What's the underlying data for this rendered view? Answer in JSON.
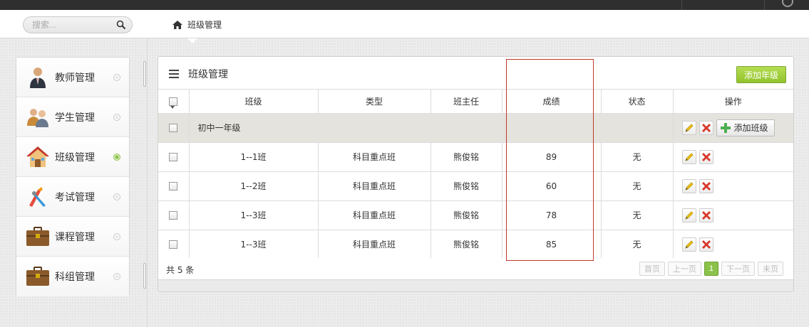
{
  "search": {
    "placeholder": "搜索..."
  },
  "breadcrumb": {
    "label": "班级管理"
  },
  "sidebar": {
    "items": [
      {
        "label": "教师管理",
        "icon": "teacher-icon",
        "active": false
      },
      {
        "label": "学生管理",
        "icon": "students-icon",
        "active": false
      },
      {
        "label": "班级管理",
        "icon": "house-icon",
        "active": true
      },
      {
        "label": "考试管理",
        "icon": "tools-icon",
        "active": false
      },
      {
        "label": "课程管理",
        "icon": "briefcase-icon",
        "active": false
      },
      {
        "label": "科组管理",
        "icon": "briefcase-icon",
        "active": false
      }
    ]
  },
  "panel": {
    "title": "班级管理",
    "add_grade_label": "添加年级",
    "columns": [
      "班级",
      "类型",
      "班主任",
      "成绩",
      "状态",
      "操作"
    ],
    "group": {
      "name": "初中一年级",
      "add_class_label": "添加班级"
    },
    "rows": [
      {
        "name": "1--1班",
        "type": "科目重点班",
        "teacher": "熊俊铭",
        "score": "89",
        "status": "无"
      },
      {
        "name": "1--2班",
        "type": "科目重点班",
        "teacher": "熊俊铭",
        "score": "60",
        "status": "无"
      },
      {
        "name": "1--3班",
        "type": "科目重点班",
        "teacher": "熊俊铭",
        "score": "78",
        "status": "无"
      },
      {
        "name": "1--3班",
        "type": "科目重点班",
        "teacher": "熊俊铭",
        "score": "85",
        "status": "无"
      }
    ],
    "total_label": "共 5 条",
    "pager": {
      "first": "首页",
      "prev": "上一页",
      "current": "1",
      "next": "下一页",
      "last": "末页"
    }
  },
  "colors": {
    "accent": "#8bc34a",
    "highlight": "#c0392b",
    "group_row": "#e4e3dd"
  }
}
